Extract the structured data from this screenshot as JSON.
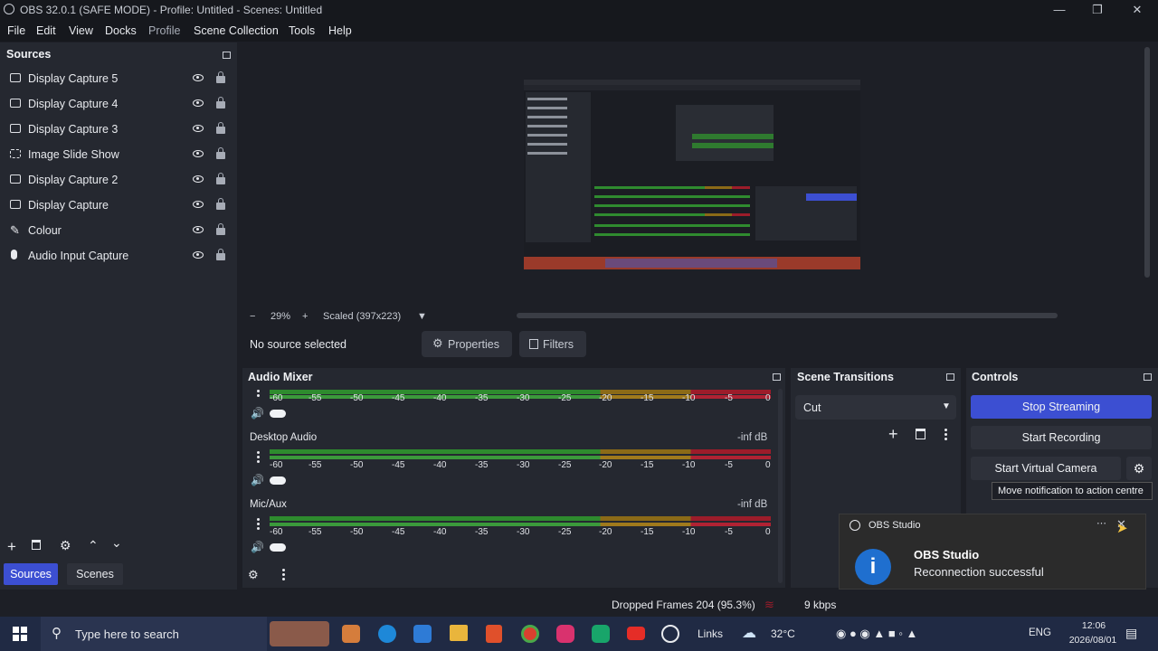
{
  "window": {
    "title": "OBS 32.0.1 (SAFE MODE) - Profile: Untitled - Scenes: Untitled"
  },
  "menu": [
    "File",
    "Edit",
    "View",
    "Docks",
    "Profile",
    "Scene Collection",
    "Tools",
    "Help"
  ],
  "sources": {
    "title": "Sources",
    "items": [
      {
        "label": "Display Capture 5",
        "icon": "monitor-icon"
      },
      {
        "label": "Display Capture 4",
        "icon": "monitor-icon"
      },
      {
        "label": "Display Capture 3",
        "icon": "monitor-icon"
      },
      {
        "label": "Image Slide Show",
        "icon": "slideshow-icon"
      },
      {
        "label": "Display Capture 2",
        "icon": "monitor-icon"
      },
      {
        "label": "Display Capture",
        "icon": "monitor-icon"
      },
      {
        "label": "Colour",
        "icon": "brush-icon"
      },
      {
        "label": "Audio Input Capture",
        "icon": "microphone-icon"
      }
    ],
    "tabs": [
      "Sources",
      "Scenes"
    ]
  },
  "preview": {
    "zoom": "29%",
    "scale": "Scaled (397x223)"
  },
  "source_bar": {
    "status": "No source selected",
    "properties": "Properties",
    "filters": "Filters"
  },
  "audio_mixer": {
    "title": "Audio Mixer",
    "ticks": [
      "-60",
      "-55",
      "-50",
      "-45",
      "-40",
      "-35",
      "-30",
      "-25",
      "-20",
      "-15",
      "-10",
      "-5",
      "0"
    ],
    "channels": [
      {
        "name": "",
        "level": ""
      },
      {
        "name": "Desktop Audio",
        "level": "-inf dB"
      },
      {
        "name": "Mic/Aux",
        "level": "-inf dB"
      }
    ]
  },
  "scene_transitions": {
    "title": "Scene Transitions",
    "selected": "Cut"
  },
  "controls": {
    "title": "Controls",
    "stop_streaming": "Stop Streaming",
    "start_recording": "Start Recording",
    "start_virtual_camera": "Start Virtual Camera"
  },
  "tooltip": "Move notification to action centre",
  "notification": {
    "app": "OBS Studio",
    "heading": "OBS Studio",
    "message": "Reconnection successful"
  },
  "statusbar": {
    "dropped_frames": "Dropped Frames 204 (95.3%)",
    "kbps": "9 kbps"
  },
  "taskbar": {
    "search_placeholder": "Type here to search",
    "links": "Links",
    "weather": "32°C",
    "lang": "ENG",
    "time": "12:06",
    "date": "2026/08/01"
  },
  "colors": {
    "accent": "#3c4fd2",
    "meter_green": "#2e8b2e",
    "meter_yellow": "#8b6a17",
    "meter_red": "#9c1c2a"
  }
}
